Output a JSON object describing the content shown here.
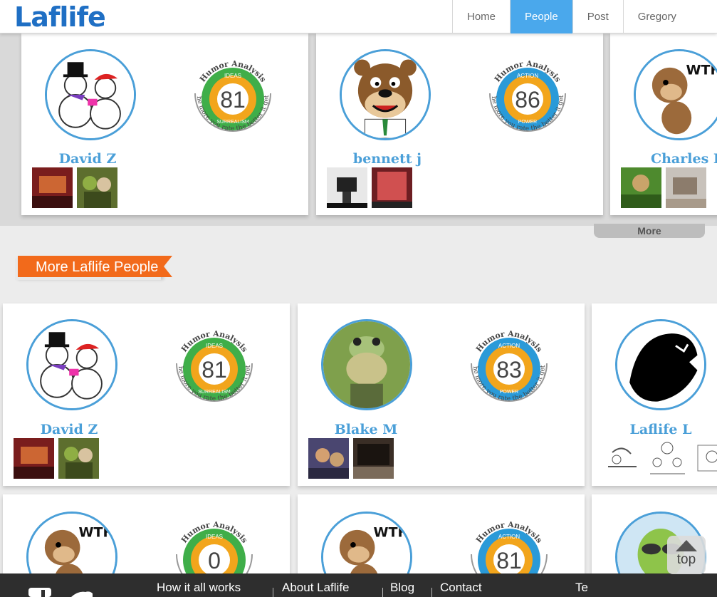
{
  "header": {
    "logo": "Laflife",
    "nav": [
      {
        "label": "Home",
        "active": false
      },
      {
        "label": "People",
        "active": true
      },
      {
        "label": "Post",
        "active": false
      },
      {
        "label": "Gregory",
        "active": false
      }
    ]
  },
  "top_cards": [
    {
      "name": "David Z",
      "score": "81",
      "top": "IDEAS",
      "bottom": "SURREALISM",
      "color": "#3fae49",
      "avatar": "snowmen-icon",
      "thumbs": [
        "photo-thumb-1",
        "photo-thumb-2"
      ]
    },
    {
      "name": "bennett j",
      "score": "86",
      "top": "ACTION",
      "bottom": "POWER",
      "color": "#2a9ad8",
      "avatar": "bear-icon",
      "thumbs": [
        "photo-thumb-3",
        "photo-thumb-4"
      ]
    },
    {
      "name": "Charles L",
      "avatar": "monkey-icon",
      "thumbs": [
        "photo-thumb-5",
        "photo-thumb-6"
      ]
    }
  ],
  "more_label": "More",
  "section_title": "More Laflife People",
  "people_cards": [
    {
      "name": "David Z",
      "score": "81",
      "top": "IDEAS",
      "bottom": "SURREALISM",
      "color": "#3fae49",
      "avatar": "snowmen-icon",
      "thumbs": [
        "photo-thumb-1",
        "photo-thumb-2"
      ]
    },
    {
      "name": "Blake M",
      "score": "83",
      "top": "ACTION",
      "bottom": "POWER",
      "color": "#2a9ad8",
      "avatar": "frog-icon",
      "thumbs": [
        "photo-thumb-7",
        "photo-thumb-8"
      ]
    },
    {
      "name": "Laflife L",
      "avatar": "laflife-logo-icon",
      "thumbs": [
        "cartoon-thumb-1",
        "cartoon-thumb-2",
        "cartoon-thumb-3"
      ]
    },
    {
      "score": "0",
      "top": "IDEAS",
      "color": "#3fae49",
      "avatar": "monkey-icon"
    },
    {
      "score": "81",
      "top": "ACTION",
      "color": "#2a9ad8",
      "avatar": "monkey-icon"
    },
    {
      "avatar": "alien-icon"
    }
  ],
  "badge": {
    "arc_text": "Humor Analysis",
    "tagline": "The more you rate the better it gets"
  },
  "top_button": "top",
  "footer": {
    "links": [
      "How it all works",
      "About Laflife",
      "Blog",
      "Contact",
      "Te"
    ],
    "icons": [
      "facebook-icon",
      "twitter-icon"
    ]
  },
  "colors": {
    "accent": "#4aa8ec",
    "orange": "#f26a1b",
    "name": "#4a9fd8",
    "green": "#3fae49",
    "blue": "#2a9ad8"
  }
}
